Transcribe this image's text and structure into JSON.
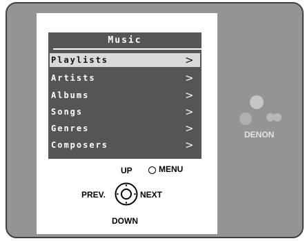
{
  "screen": {
    "title": "Music",
    "items": [
      {
        "label": "Playlists",
        "arrow": ">"
      },
      {
        "label": "Artists",
        "arrow": ">"
      },
      {
        "label": "Albums",
        "arrow": ">"
      },
      {
        "label": "Songs",
        "arrow": ">"
      },
      {
        "label": "Genres",
        "arrow": ">"
      },
      {
        "label": "Composers",
        "arrow": ">"
      }
    ],
    "selected_index": 0
  },
  "controls": {
    "up": "UP",
    "menu": "MENU",
    "prev": "PREV.",
    "next": "NEXT",
    "down": "DOWN"
  },
  "brand": {
    "name": "DENON"
  },
  "colors": {
    "device_body": "#949494",
    "screen_bg": "#555555",
    "selection_bg": "#d9d9d9",
    "screen_text": "#ffffff"
  },
  "icons": [
    "circle-menu-icon",
    "center-select-dial-icon",
    "denon-logo-dots"
  ]
}
